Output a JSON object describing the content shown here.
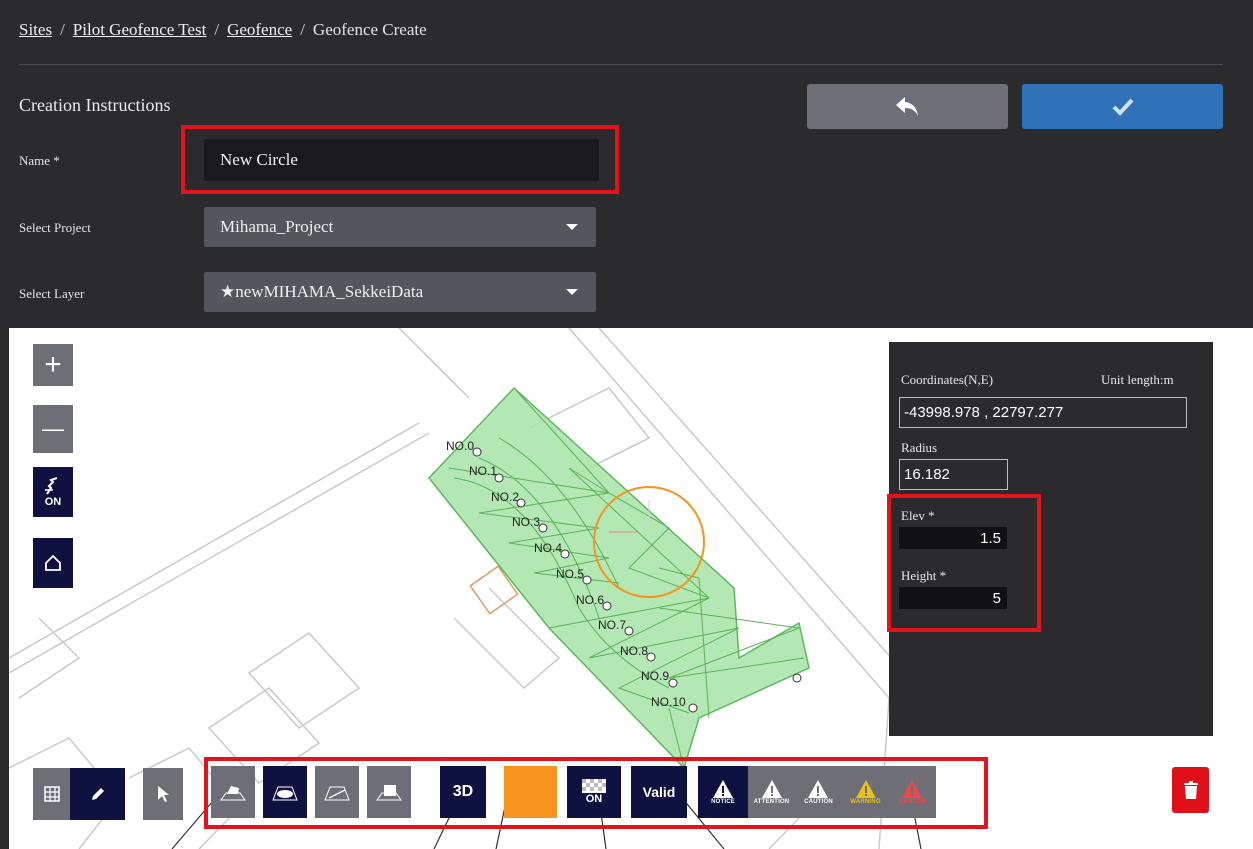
{
  "breadcrumb": {
    "items": [
      "Sites",
      "Pilot Geofence Test",
      "Geofence"
    ],
    "current": "Geofence Create"
  },
  "page_title": "Creation Instructions",
  "buttons": {
    "back_icon": "reply-arrow-icon",
    "confirm_icon": "checkmark-icon"
  },
  "form": {
    "name_label": "Name *",
    "name_value": "New Circle",
    "project_label": "Select Project",
    "project_value": "Mihama_Project",
    "layer_label": "Select Layer",
    "layer_value": "★newMIHAMA_SekkeiData"
  },
  "map_controls": {
    "zoom_in": "+",
    "zoom_out": "—",
    "snap_label": "ON"
  },
  "station_labels": [
    "NO.0",
    "NO.1",
    "NO.2",
    "NO.3",
    "NO.4",
    "NO.5",
    "NO.6",
    "NO.7",
    "NO.8",
    "NO.9",
    "NO.10"
  ],
  "panel": {
    "coords_label": "Coordinates(N,E)",
    "unit_label": "Unit length:m",
    "coords_value": "-43998.978 , 22797.277",
    "radius_label": "Radius",
    "radius_value": "16.182",
    "elev_label": "Elev *",
    "elev_value": "1.5",
    "height_label": "Height *",
    "height_value": "5"
  },
  "toolbar": {
    "three_d": "3D",
    "texture_on": "ON",
    "valid": "Valid",
    "levels": [
      "NOTICE",
      "ATTENTION",
      "CAUTION",
      "WARNING",
      "DANGER"
    ],
    "color_swatch": "#f7931e"
  },
  "colors": {
    "accent_blue": "#2f72b8",
    "navy": "#0f1140",
    "highlight_red": "#e3121b",
    "geofence_green": "#8fd68f",
    "circle_orange": "#f7931e"
  }
}
